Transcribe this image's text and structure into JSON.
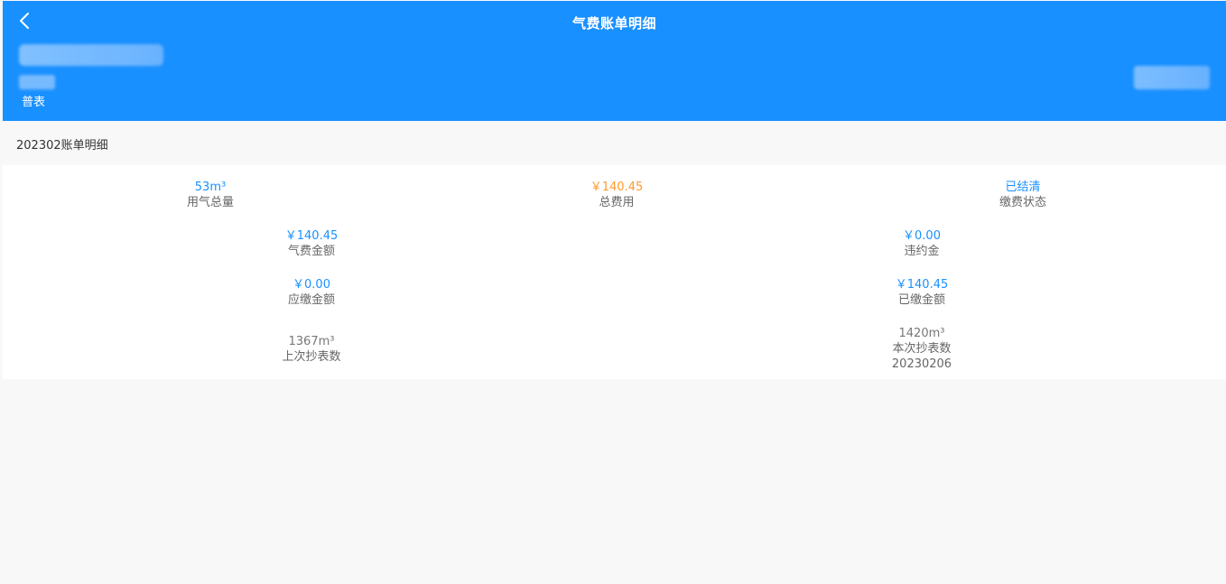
{
  "header": {
    "title": "气费账单明细",
    "meter_type": "普表",
    "background_color": "#1990ff"
  },
  "bill": {
    "section_title": "202302账单明细",
    "total_gas": {
      "value": "53m³",
      "label": "用气总量"
    },
    "total_fee": {
      "value": "￥140.45",
      "label": "总费用"
    },
    "payment_status": {
      "value": "已结清",
      "label": "缴费状态"
    },
    "gas_fee_amount": {
      "value": "￥140.45",
      "label": "气费金额"
    },
    "penalty": {
      "value": "￥0.00",
      "label": "违约金"
    },
    "amount_due": {
      "value": "￥0.00",
      "label": "应缴金额"
    },
    "amount_paid": {
      "value": "￥140.45",
      "label": "已缴金额"
    },
    "last_reading": {
      "value": "1367m³",
      "label": "上次抄表数"
    },
    "current_reading": {
      "value": "1420m³",
      "label": "本次抄表数",
      "date": "20230206"
    }
  },
  "icons": {
    "back": "chevron-left-icon"
  },
  "colors": {
    "accent_blue": "#1990ff",
    "orange": "#ff9a2e",
    "label_grey": "#666666"
  }
}
